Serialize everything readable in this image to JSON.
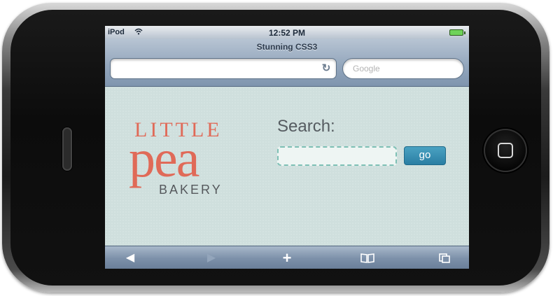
{
  "status_bar": {
    "carrier": "iPod",
    "time": "12:52 PM",
    "wifi_icon": "wifi-icon",
    "battery_icon": "battery-icon"
  },
  "browser": {
    "title": "Stunning CSS3",
    "url_value": "",
    "google_placeholder": "Google",
    "reload_icon": "reload-icon"
  },
  "page": {
    "logo": {
      "top": "LITTLE",
      "mid": "pea",
      "bottom": "BAKERY"
    },
    "search_label": "Search:",
    "search_value": "",
    "go_label": "go"
  },
  "toolbar": {
    "back_icon": "◀",
    "forward_icon": "▶",
    "add_icon": "+",
    "bookmarks_icon": "📖",
    "pages_icon": "⧉"
  },
  "colors": {
    "logo_accent": "#e06a58",
    "page_background": "#cfdfdd",
    "go_button": "#2a7ea3",
    "chrome": "#94a7bd"
  }
}
